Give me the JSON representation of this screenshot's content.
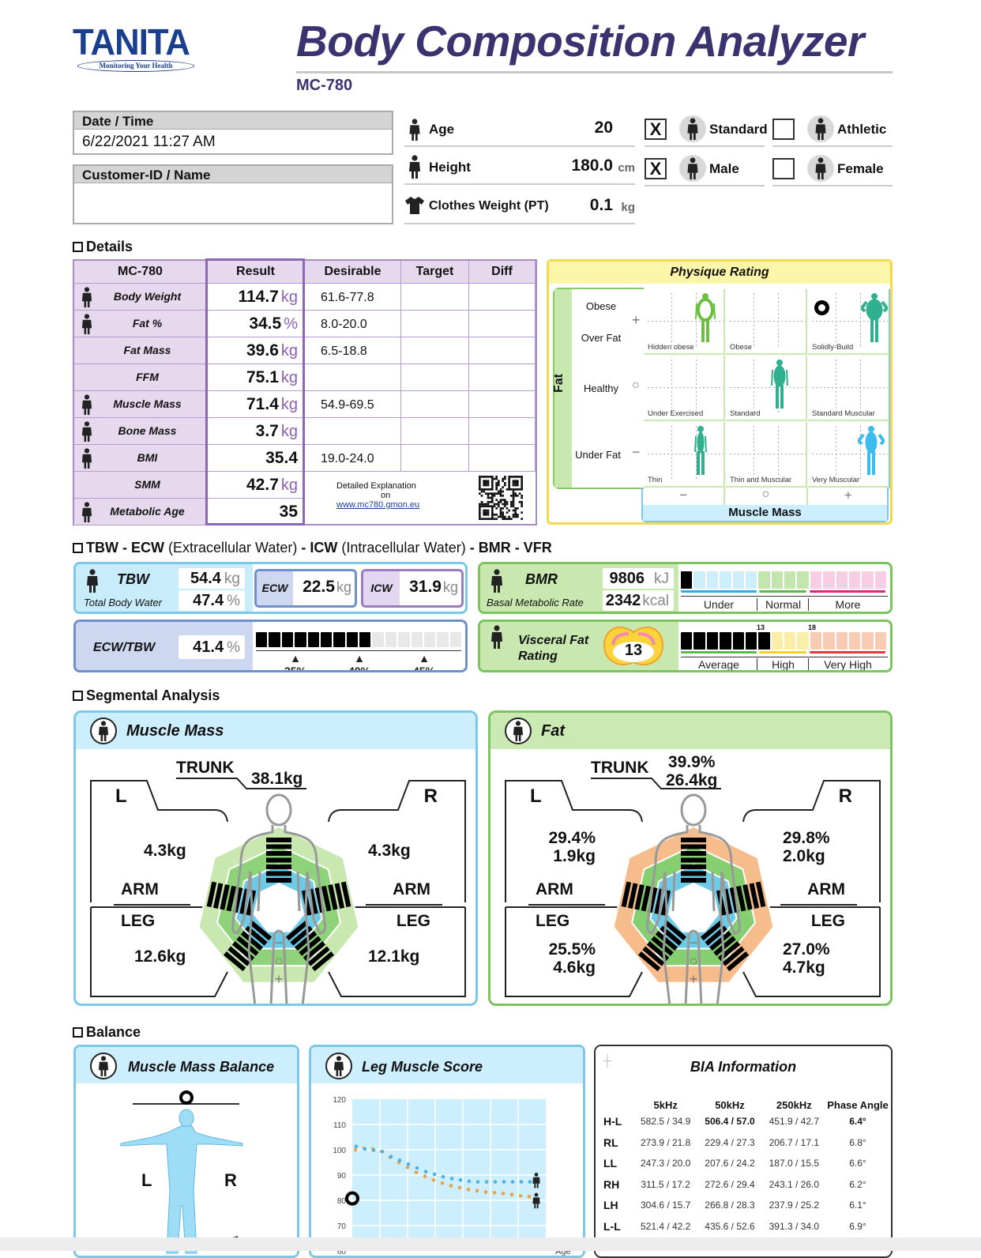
{
  "header": {
    "logo": "TANITA",
    "logo_tagline": "Monitoring Your Health",
    "title": "Body Composition Analyzer",
    "model": "MC-780"
  },
  "datetime": {
    "label": "Date / Time",
    "value": "6/22/2021 11:27 AM"
  },
  "customer": {
    "label": "Customer-ID / Name",
    "value": ""
  },
  "profile": {
    "age": {
      "label": "Age",
      "value": "20",
      "unit": "",
      "icon": "person-icon"
    },
    "height": {
      "label": "Height",
      "value": "180.0",
      "unit": "cm",
      "icon": "height-icon"
    },
    "clothes": {
      "label": "Clothes Weight (PT)",
      "value": "0.1",
      "unit": "kg",
      "icon": "shirt-icon"
    },
    "body_type": [
      {
        "label": "Standard",
        "mark": "X",
        "checked": true,
        "icon": "standard-person-icon"
      },
      {
        "label": "Athletic",
        "mark": "",
        "checked": false,
        "icon": "athlete-icon"
      }
    ],
    "gender": [
      {
        "label": "Male",
        "mark": "X",
        "checked": true,
        "icon": "male-icon"
      },
      {
        "label": "Female",
        "mark": "",
        "checked": false,
        "icon": "female-icon"
      }
    ]
  },
  "details": {
    "section": "Details",
    "columns": [
      "MC-780",
      "Result",
      "Desirable",
      "Target",
      "Diff"
    ],
    "rows": [
      {
        "label": "Body Weight",
        "value": "114.7",
        "unit": "kg",
        "desirable": "61.6-77.8",
        "icon": "weight-icon"
      },
      {
        "label": "Fat %",
        "value": "34.5",
        "unit": "%",
        "desirable": "8.0-20.0",
        "icon": "fat-percent-icon"
      },
      {
        "label": "Fat Mass",
        "value": "39.6",
        "unit": "kg",
        "desirable": "6.5-18.8",
        "icon": ""
      },
      {
        "label": "FFM",
        "value": "75.1",
        "unit": "kg",
        "desirable": "",
        "icon": ""
      },
      {
        "label": "Muscle Mass",
        "value": "71.4",
        "unit": "kg",
        "desirable": "54.9-69.5",
        "icon": "muscle-icon"
      },
      {
        "label": "Bone Mass",
        "value": "3.7",
        "unit": "kg",
        "desirable": "",
        "icon": "bone-icon"
      },
      {
        "label": "BMI",
        "value": "35.4",
        "unit": "",
        "desirable": "19.0-24.0",
        "icon": "bmi-icon"
      },
      {
        "label": "SMM",
        "value": "42.7",
        "unit": "kg",
        "icon": ""
      },
      {
        "label": "Metabolic Age",
        "value": "35",
        "unit": "",
        "icon": "metabolic-age-icon"
      }
    ],
    "explanation": {
      "line1": "Detailed Explanation",
      "line2": "on",
      "link": "www.mc780.gmon.eu"
    }
  },
  "physique": {
    "title": "Physique Rating",
    "fat_axis": "Fat",
    "muscle_axis": "Muscle Mass",
    "fat_levels": [
      "Obese",
      "Over Fat",
      "Healthy",
      "Under Fat"
    ],
    "fat_symbols": [
      "+",
      "○",
      "−"
    ],
    "muscle_symbols": [
      "−",
      "○",
      "+"
    ],
    "cells": [
      "Hidden obese",
      "Obese",
      "Solidly-Build",
      "Under Exercised",
      "Standard",
      "Standard Muscular",
      "Thin",
      "Thin and Muscular",
      "Very Muscular"
    ],
    "rating": "Solidly-Build"
  },
  "water": {
    "section_parts": [
      "TBW - ECW",
      " (Extracellular Water) ",
      "- ICW",
      " (Intracellular Water) ",
      "- BMR - VFR"
    ],
    "tbw": {
      "label": "TBW",
      "sublabel": "Total Body Water",
      "kg": "54.4",
      "kg_unit": "kg",
      "pct": "47.4",
      "pct_unit": "%"
    },
    "ecw": {
      "label": "ECW",
      "value": "22.5",
      "unit": "kg"
    },
    "icw": {
      "label": "ICW",
      "value": "31.9",
      "unit": "kg"
    },
    "ecw_tbw": {
      "label": "ECW/TBW",
      "value": "41.4",
      "unit": "%",
      "bar_level": 9,
      "bar_segments": 16,
      "ticks": [
        "35%",
        "40%",
        "45%"
      ]
    }
  },
  "bmr": {
    "label": "BMR",
    "sublabel": "Basal Metabolic Rate",
    "kj": "9806",
    "kj_unit": "kJ",
    "kcal": "2342",
    "kcal_unit": "kcal",
    "bar_level": 1,
    "ranges": [
      "Under",
      "Normal",
      "More"
    ],
    "colors": {
      "under": "#cdeefb",
      "normal": "#c2e6ad",
      "more": "#f9cde3"
    }
  },
  "vfr": {
    "label_1": "Visceral Fat",
    "label_2": "Rating",
    "value": "13",
    "bar_level": 7,
    "marks": [
      "13",
      "18"
    ],
    "ranges": [
      "Average",
      "High",
      "Very High"
    ],
    "colors": {
      "high": "#fbeea8",
      "very_high": "#f8cbb5"
    }
  },
  "segmental": {
    "section": "Segmental Analysis",
    "muscle": {
      "title": "Muscle Mass",
      "trunk_label": "TRUNK",
      "trunk": "38.1kg",
      "left_arm": "4.3kg",
      "right_arm": "4.3kg",
      "left_leg": "12.6kg",
      "right_leg": "12.1kg",
      "bar_levels": {
        "trunk": 7,
        "left_arm": 7,
        "right_arm": 7,
        "left_leg": 7,
        "right_leg": 7
      },
      "colors": {
        "outer": "#c8e8b0",
        "middle": "#8ed37a",
        "inner": "#6ccbe8"
      }
    },
    "fat": {
      "title": "Fat",
      "trunk_label": "TRUNK",
      "trunk_pct": "39.9%",
      "trunk": "26.4kg",
      "left_arm_pct": "29.4%",
      "left_arm": "1.9kg",
      "right_arm_pct": "29.8%",
      "right_arm": "2.0kg",
      "left_leg_pct": "25.5%",
      "left_leg": "4.6kg",
      "right_leg_pct": "27.0%",
      "right_leg": "4.7kg",
      "bar_levels": {
        "trunk": 7,
        "left_arm": 7,
        "right_arm": 7,
        "left_leg": 7,
        "right_leg": 7
      },
      "colors": {
        "outer": "#f6bc8c",
        "middle": "#86cf70",
        "inner": "#6ccbe8"
      }
    },
    "left": "L",
    "right": "R",
    "arm": "ARM",
    "leg": "LEG",
    "scale": [
      "−",
      "○",
      "+"
    ]
  },
  "balance": {
    "section": "Balance",
    "muscle_balance": {
      "title": "Muscle Mass Balance",
      "left": "L",
      "right": "R"
    },
    "leg_score": {
      "title": "Leg Muscle Score",
      "score": "77",
      "score_value": 77,
      "x_label": "Age",
      "y_ticks": [
        "120",
        "110",
        "100",
        "90",
        "80",
        "70",
        "60"
      ],
      "ylim": [
        60,
        120
      ],
      "male_curve": [
        101,
        100,
        99.5,
        99,
        97,
        95.5,
        94,
        92.5,
        91,
        90,
        89,
        88.3,
        87.7,
        87.2,
        87,
        87,
        87,
        87,
        87,
        87,
        87
      ],
      "female_curve": [
        100,
        100.5,
        100.3,
        99.3,
        97,
        95,
        93,
        91,
        89.5,
        88,
        86.8,
        85.8,
        85,
        84.3,
        83.8,
        83.3,
        83,
        82.7,
        82.3,
        81.8,
        81.5
      ],
      "colors": {
        "male": "#4ab3e6",
        "female": "#e9a24a"
      }
    },
    "bia": {
      "title": "BIA Information",
      "columns": [
        "5kHz",
        "50kHz",
        "250kHz",
        "Phase Angle"
      ],
      "rows": [
        {
          "label": "H-L",
          "v5": "582.5 / 34.9",
          "v50": "506.4 / 57.0",
          "v250": "451.9 / 42.7",
          "phase": "6.4°"
        },
        {
          "label": "RL",
          "v5": "273.9 / 21.8",
          "v50": "229.4 / 27.3",
          "v250": "206.7 / 17.1",
          "phase": "6.8°"
        },
        {
          "label": "LL",
          "v5": "247.3 / 20.0",
          "v50": "207.6 / 24.2",
          "v250": "187.0 / 15.5",
          "phase": "6.6°"
        },
        {
          "label": "RH",
          "v5": "311.5 / 17.2",
          "v50": "272.6 / 29.4",
          "v250": "243.1 / 26.0",
          "phase": "6.2°"
        },
        {
          "label": "LH",
          "v5": "304.6 / 15.7",
          "v50": "266.8 / 28.3",
          "v250": "237.9 / 25.2",
          "phase": "6.1°"
        },
        {
          "label": "L-L",
          "v5": "521.4 / 42.2",
          "v50": "435.6 / 52.6",
          "v250": "391.3 / 34.0",
          "phase": "6.9°"
        }
      ]
    }
  }
}
